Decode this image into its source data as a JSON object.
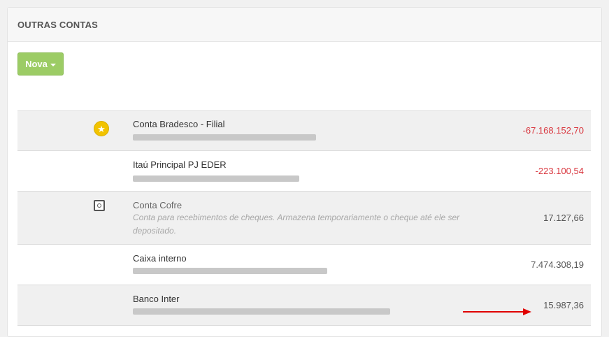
{
  "panel": {
    "title": "OUTRAS CONTAS",
    "new_button_label": "Nova"
  },
  "accounts": [
    {
      "name": "Conta Bradesco - Filial",
      "icon": "star-icon",
      "amount": "-67.168.152,70",
      "amount_color": "#d9363e"
    },
    {
      "name": "Itaú Principal PJ EDER",
      "icon": "",
      "amount": "-223.100,54",
      "amount_color": "#d9363e"
    },
    {
      "name": "Conta Cofre",
      "icon": "safe-icon",
      "description": "Conta para recebimentos de cheques. Armazena temporariamente o cheque até ele ser depositado.",
      "amount": "17.127,66",
      "amount_color": "#555555"
    },
    {
      "name": "Caixa interno",
      "icon": "",
      "amount": "7.474.308,19",
      "amount_color": "#555555"
    },
    {
      "name": "Banco Inter",
      "icon": "",
      "amount": "15.987,36",
      "amount_color": "#555555"
    }
  ],
  "colors": {
    "accent_button": "#9ccc65",
    "negative": "#d9363e",
    "annotation_arrow": "#e00000"
  }
}
